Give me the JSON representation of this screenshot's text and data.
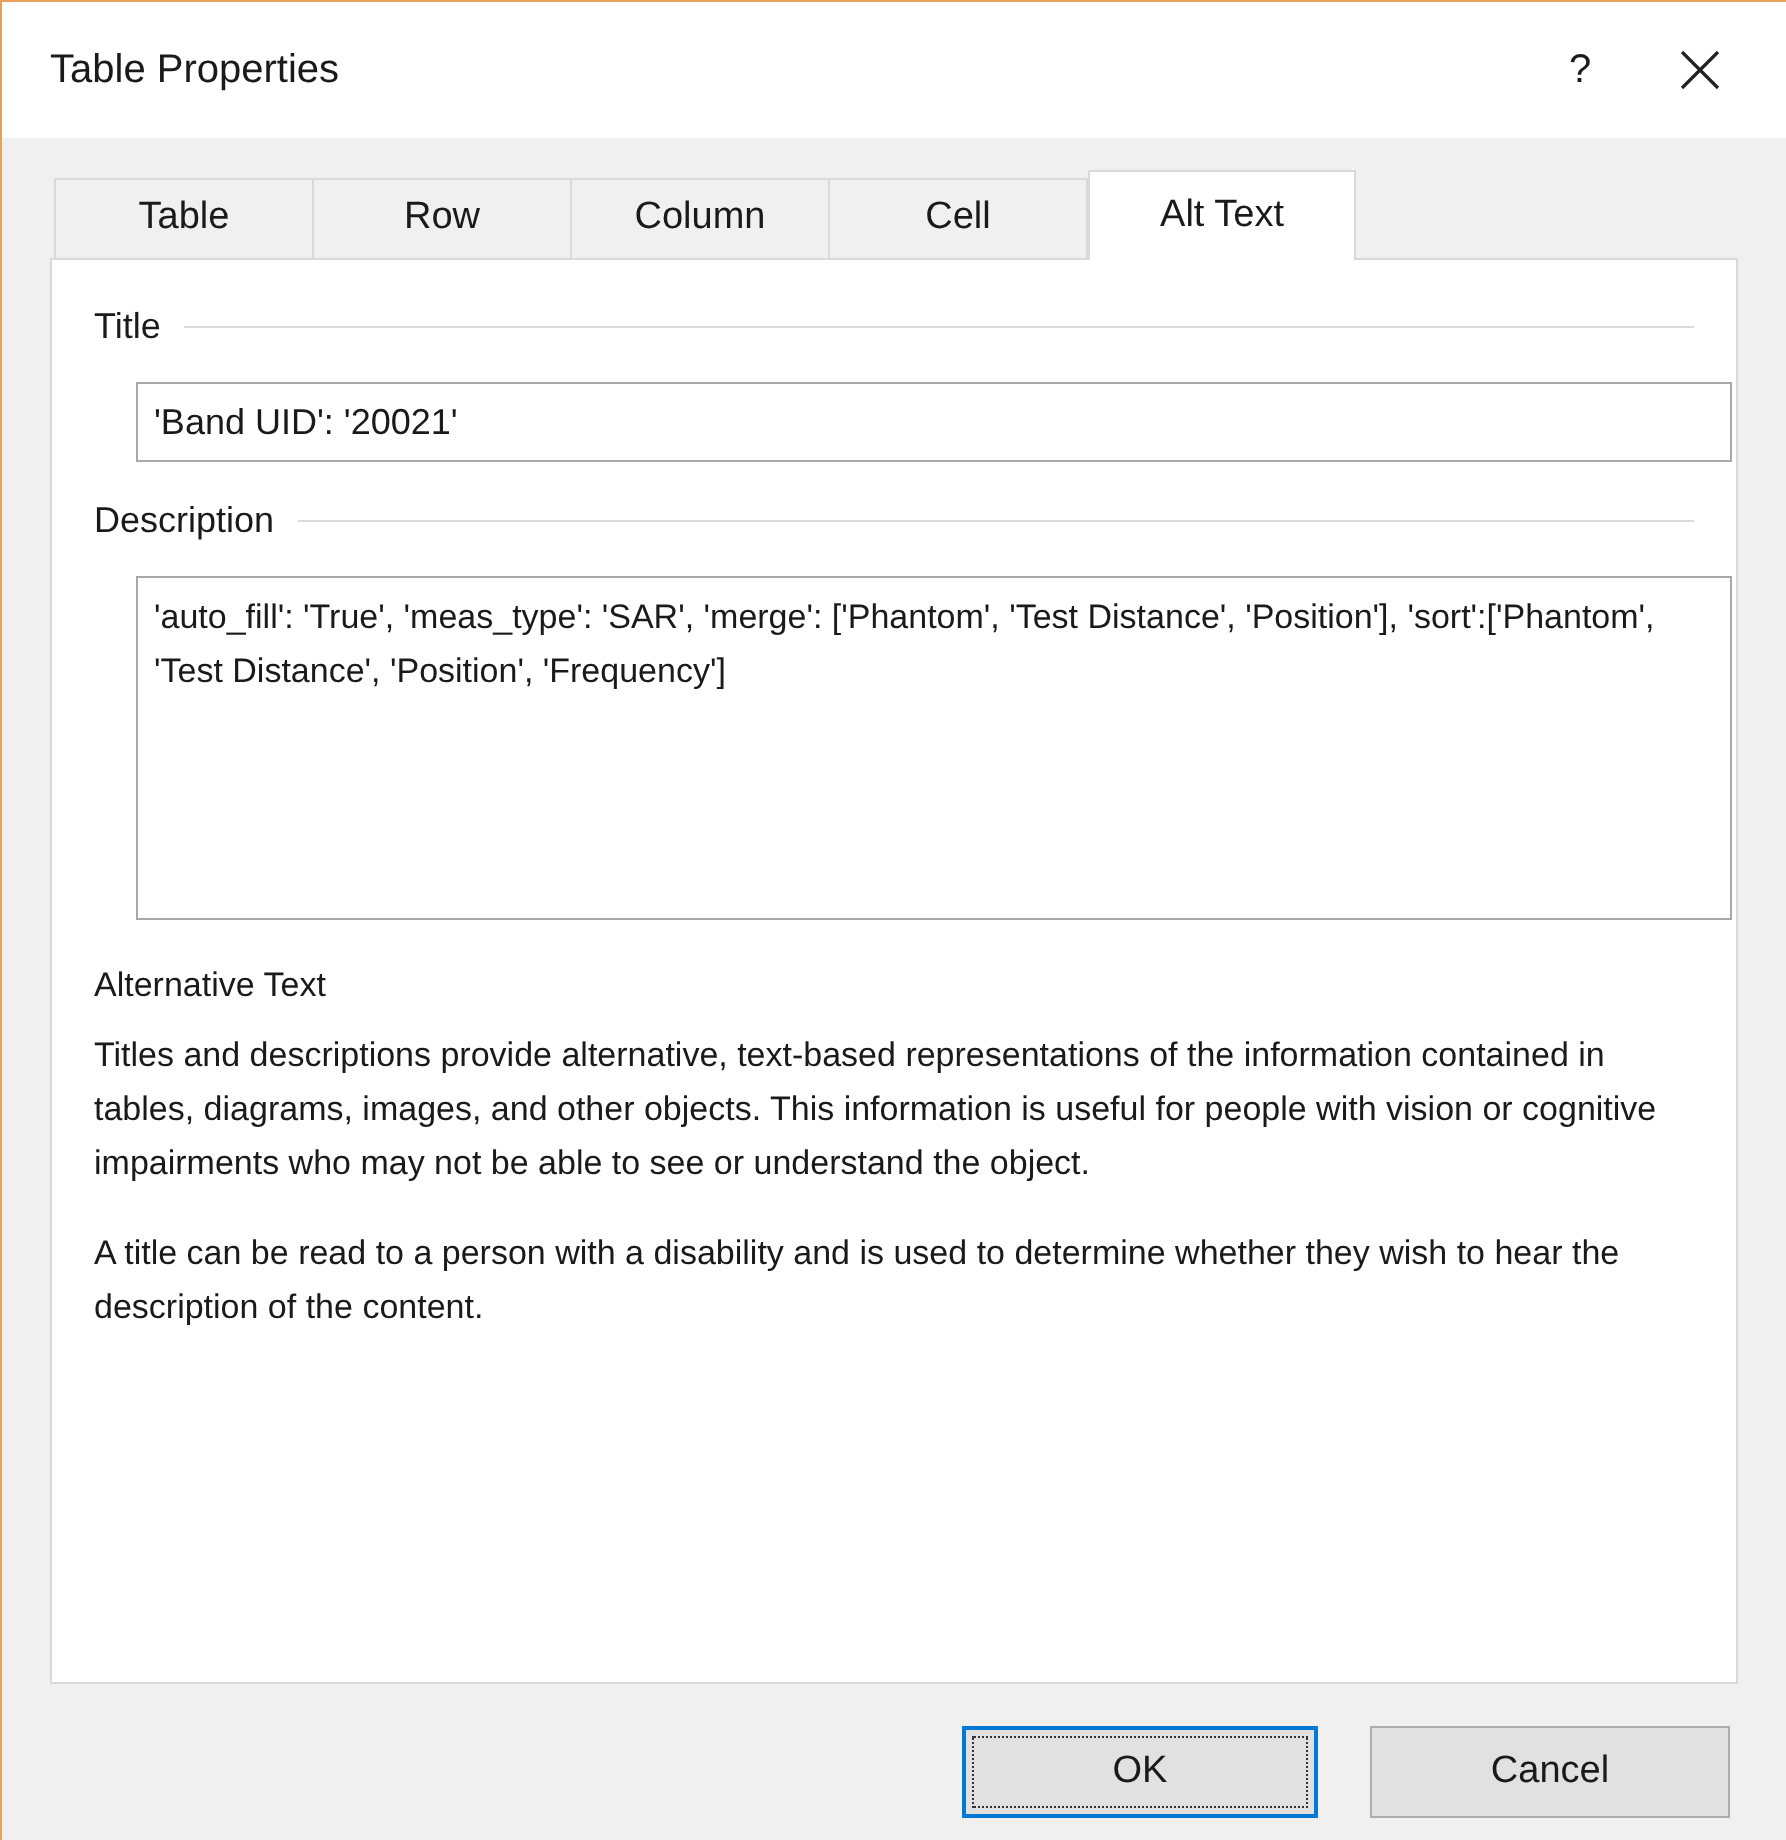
{
  "window": {
    "title": "Table Properties",
    "help": "?"
  },
  "tabs": [
    {
      "label": "Table",
      "selected": false
    },
    {
      "label": "Row",
      "selected": false
    },
    {
      "label": "Column",
      "selected": false
    },
    {
      "label": "Cell",
      "selected": false
    },
    {
      "label": "Alt Text",
      "selected": true
    }
  ],
  "title_group": {
    "label": "Title",
    "value": "'Band UID': '20021'"
  },
  "description_group": {
    "label": "Description",
    "value": "'auto_fill': 'True', 'meas_type': 'SAR', 'merge': ['Phantom', 'Test Distance', 'Position'], 'sort':['Phantom',  'Test Distance', 'Position', 'Frequency']"
  },
  "help": {
    "heading": "Alternative Text",
    "paragraphs": [
      "Titles and descriptions provide alternative, text-based representations of the information contained in tables, diagrams, images, and other objects. This information is useful for people with vision or cognitive impairments who may not be able to see or understand the object.",
      "A title can be read to a person with a disability and is used to determine whether they wish to hear the description of the content."
    ]
  },
  "buttons": [
    {
      "label": "OK",
      "focused": true
    },
    {
      "label": "Cancel",
      "focused": false
    }
  ]
}
